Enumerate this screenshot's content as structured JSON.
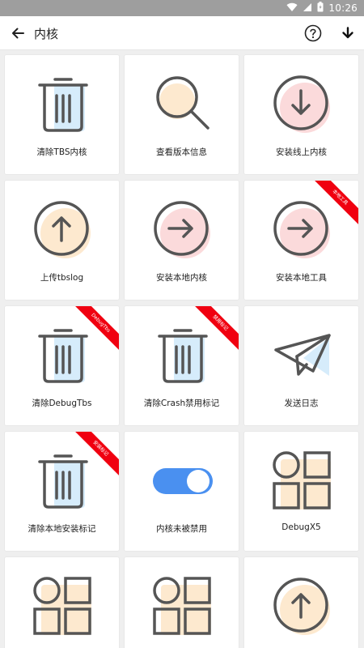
{
  "status_bar": {
    "time": "10:26",
    "icons": [
      "wifi-icon",
      "signal-icon",
      "battery-icon"
    ]
  },
  "app_bar": {
    "title": "内核",
    "icons": [
      "back-arrow-icon",
      "help-icon",
      "download-icon"
    ]
  },
  "colors": {
    "icon_stroke": "#555555",
    "blue_fill": "#d6ecfb",
    "orange_fill": "#fde9cf",
    "pink_fill": "#fbdadb",
    "ribbon": "#f00010",
    "toggle_on": "#4a90f0"
  },
  "tiles": [
    {
      "label": "清除TBS内核",
      "icon": "trash-icon"
    },
    {
      "label": "查看版本信息",
      "icon": "magnifier-icon"
    },
    {
      "label": "安装线上内核",
      "icon": "arrow-down-circle-icon"
    },
    {
      "label": "上传tbslog",
      "icon": "arrow-up-circle-icon"
    },
    {
      "label": "安装本地内核",
      "icon": "arrow-right-circle-icon"
    },
    {
      "label": "安装本地工具",
      "icon": "arrow-right-circle-icon",
      "ribbon": "本地工具"
    },
    {
      "label": "清除DebugTbs",
      "icon": "trash-icon",
      "ribbon": "DebugTbs"
    },
    {
      "label": "清除Crash禁用标记",
      "icon": "trash-icon",
      "ribbon": "禁用标记"
    },
    {
      "label": "发送日志",
      "icon": "paper-plane-icon"
    },
    {
      "label": "清除本地安装标记",
      "icon": "trash-icon",
      "ribbon": "安装标记"
    },
    {
      "label": "内核未被禁用",
      "icon": "toggle-on-icon"
    },
    {
      "label": "DebugX5",
      "icon": "grid-apps-icon"
    },
    {
      "label": "",
      "icon": "grid-apps-icon"
    },
    {
      "label": "",
      "icon": "grid-apps-icon"
    },
    {
      "label": "",
      "icon": "arrow-up-circle-icon"
    }
  ]
}
